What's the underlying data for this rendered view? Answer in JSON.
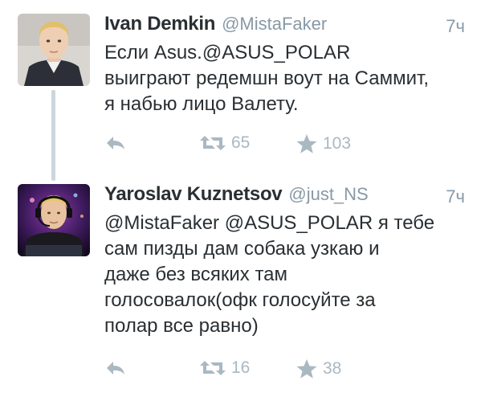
{
  "tweets": [
    {
      "name": "Ivan Demkin",
      "handle": "@MistaFaker",
      "time": "7ч",
      "lines": [
        "Если Asus.@ASUS_POLAR",
        "выиграют редемшн воут на Саммит,",
        "я набью лицо Валету."
      ],
      "retweets": "65",
      "favorites": "103"
    },
    {
      "name": "Yaroslav Kuznetsov",
      "handle": "@just_NS",
      "time": "7ч",
      "lines": [
        "@MistaFaker @ASUS_POLAR я тебе",
        "сам пизды дам собака узкаю и",
        "даже без всяких там",
        "голосовалок(офк голосуйте за",
        "полар все равно)"
      ],
      "retweets": "16",
      "favorites": "38"
    }
  ],
  "colors": {
    "text": "#292f33",
    "muted": "#8899a6",
    "icon": "#aab8c2",
    "thread_line": "#ccd6dd"
  },
  "icons": {
    "reply": "reply-icon",
    "retweet": "retweet-icon",
    "favorite": "star-icon"
  }
}
